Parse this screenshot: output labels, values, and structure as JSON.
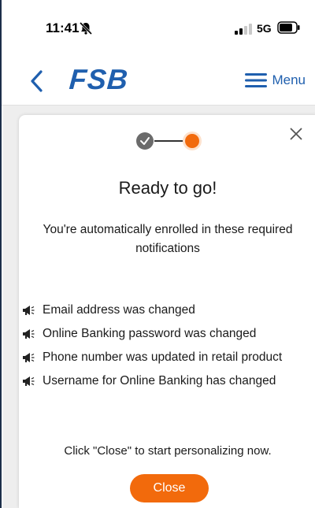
{
  "status_bar": {
    "time": "11:41",
    "network": "5G",
    "icons": [
      "bell-slash-icon",
      "signal-bars-icon",
      "battery-icon"
    ]
  },
  "header": {
    "back_icon": "chevron-left-icon",
    "brand": "FSB",
    "menu_label": "Menu",
    "menu_icon": "hamburger-icon"
  },
  "modal": {
    "stepper": {
      "steps": 2,
      "current": 2,
      "completed_icon": "check-icon"
    },
    "close_icon": "close-x-icon",
    "title": "Ready to go!",
    "subtitle": "You're automatically enrolled in these required notifications",
    "notifications": [
      {
        "icon": "megaphone-icon",
        "label": "Email address was changed"
      },
      {
        "icon": "megaphone-icon",
        "label": "Online Banking password was changed"
      },
      {
        "icon": "megaphone-icon",
        "label": "Phone number was updated in retail product"
      },
      {
        "icon": "megaphone-icon",
        "label": "Username for Online Banking has changed"
      }
    ],
    "hint": "Click \"Close\" to start personalizing now.",
    "close_button": "Close"
  },
  "colors": {
    "brand_blue": "#1f5fae",
    "accent_orange": "#f26a0c",
    "step_done_gray": "#6b6b6b"
  }
}
